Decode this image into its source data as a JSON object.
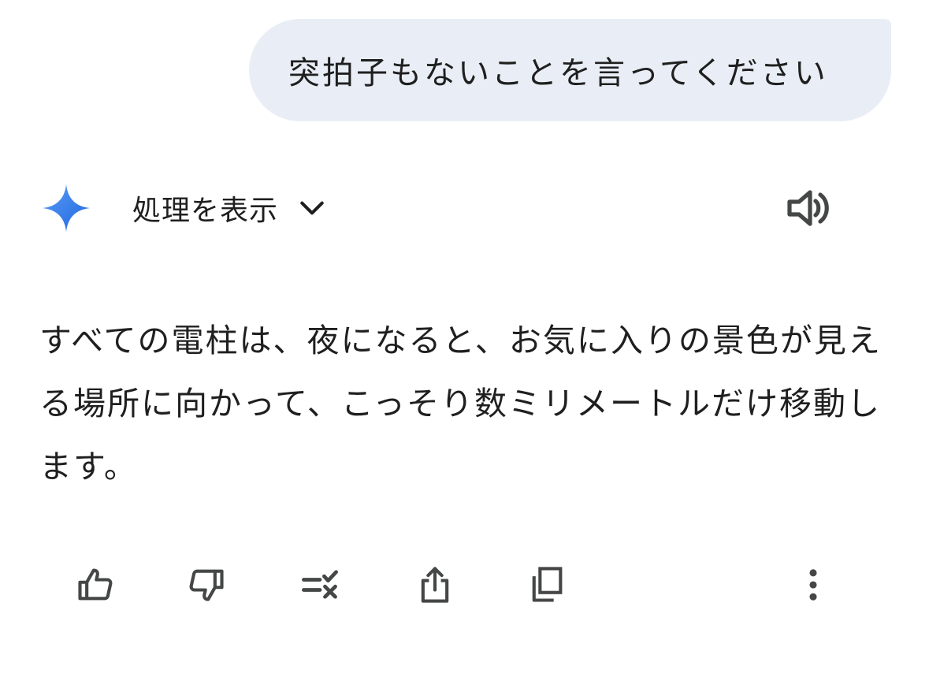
{
  "user_message": {
    "text": "突拍子もないことを言ってください"
  },
  "response": {
    "thinking_label": "処理を表示",
    "text": "すべての電柱は、夜になると、お気に入りの景色が見える場所に向かって、こっそり数ミリメートルだけ移動します。"
  },
  "icons": {
    "assistant": "gemini-sparkle-icon",
    "expand": "chevron-down-icon",
    "read_aloud": "speaker-icon",
    "like": "thumbs-up-icon",
    "dislike": "thumbs-down-icon",
    "modify": "modify-response-icon",
    "share": "share-icon",
    "copy": "copy-icon",
    "more": "more-vertical-icon"
  },
  "colors": {
    "bubble_background": "#e9eef6",
    "text": "#1f1f1f",
    "icon": "#444746",
    "sparkle_start": "#4c8df6",
    "sparkle_end": "#1f6ae0"
  }
}
